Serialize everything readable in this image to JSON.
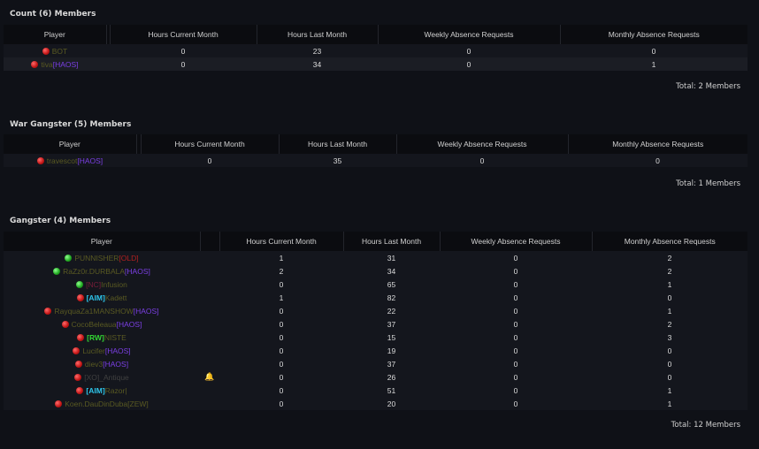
{
  "headers": {
    "player": "Player",
    "hours_current": "Hours Current Month",
    "hours_last": "Hours Last Month",
    "weekly": "Weekly Absence Requests",
    "monthly": "Monthly Absence Requests"
  },
  "colors": {
    "background": "#0f1117",
    "online": "#1fa61f",
    "offline": "#c21414",
    "haos_tag": "#7b3fe4",
    "aim_tag": "#2ec4e8",
    "rw_tag": "#33d433"
  },
  "sections": [
    {
      "title": "Count (6) Members",
      "total": "Total: 2 Members",
      "rows": [
        {
          "status": "red",
          "parts": [
            {
              "t": "BOT",
              "c": "name"
            }
          ],
          "hc": "0",
          "hl": "23",
          "w": "0",
          "m": "0"
        },
        {
          "status": "red",
          "parts": [
            {
              "t": "tiva",
              "c": "name"
            },
            {
              "t": "[HAOS]",
              "c": "tag-haos"
            }
          ],
          "hc": "0",
          "hl": "34",
          "w": "0",
          "m": "1"
        }
      ]
    },
    {
      "title": "War Gangster (5) Members",
      "total": "Total: 1 Members",
      "rows": [
        {
          "status": "red",
          "parts": [
            {
              "t": "travescot",
              "c": "name"
            },
            {
              "t": "[HAOS]",
              "c": "tag-haos"
            }
          ],
          "hc": "0",
          "hl": "35",
          "w": "0",
          "m": "0"
        }
      ]
    },
    {
      "title": "Gangster (4) Members",
      "total": "Total: 12 Members",
      "rows": [
        {
          "status": "green",
          "parts": [
            {
              "t": "PUNNISHER",
              "c": "name"
            },
            {
              "t": "[OLD]",
              "c": "tag-old"
            }
          ],
          "hc": "1",
          "hl": "31",
          "w": "0",
          "m": "2"
        },
        {
          "status": "green",
          "parts": [
            {
              "t": "RaZz0r.DURBALA",
              "c": "name"
            },
            {
              "t": "[HAOS]",
              "c": "tag-haos"
            }
          ],
          "hc": "2",
          "hl": "34",
          "w": "0",
          "m": "2"
        },
        {
          "status": "green",
          "parts": [
            {
              "t": "[NC]",
              "c": "tag-nc"
            },
            {
              "t": "Infusion",
              "c": "name"
            }
          ],
          "hc": "0",
          "hl": "65",
          "w": "0",
          "m": "1"
        },
        {
          "status": "red",
          "parts": [
            {
              "t": "[AIM]",
              "c": "tag-aim"
            },
            {
              "t": "Kadett",
              "c": "name"
            }
          ],
          "hc": "1",
          "hl": "82",
          "w": "0",
          "m": "0"
        },
        {
          "status": "red",
          "parts": [
            {
              "t": "RayquaZa1MANSHOW",
              "c": "name"
            },
            {
              "t": "[HAOS]",
              "c": "tag-haos"
            }
          ],
          "hc": "0",
          "hl": "22",
          "w": "0",
          "m": "1"
        },
        {
          "status": "red",
          "parts": [
            {
              "t": "CocoBeleaua",
              "c": "name"
            },
            {
              "t": "[HAOS]",
              "c": "tag-haos"
            }
          ],
          "hc": "0",
          "hl": "37",
          "w": "0",
          "m": "2"
        },
        {
          "status": "red",
          "parts": [
            {
              "t": "[RW]",
              "c": "tag-rw"
            },
            {
              "t": "NISTE",
              "c": "name"
            }
          ],
          "hc": "0",
          "hl": "15",
          "w": "0",
          "m": "3"
        },
        {
          "status": "red",
          "parts": [
            {
              "t": "Lucifer",
              "c": "name"
            },
            {
              "t": "[HAOS]",
              "c": "tag-haos"
            }
          ],
          "hc": "0",
          "hl": "19",
          "w": "0",
          "m": "0"
        },
        {
          "status": "red",
          "parts": [
            {
              "t": "diev3",
              "c": "name"
            },
            {
              "t": "[HAOS]",
              "c": "tag-haos"
            }
          ],
          "hc": "0",
          "hl": "37",
          "w": "0",
          "m": "0"
        },
        {
          "status": "red",
          "parts": [
            {
              "t": "[XO]_Antique",
              "c": "tag-xo"
            }
          ],
          "bell": true,
          "hc": "0",
          "hl": "26",
          "w": "0",
          "m": "0"
        },
        {
          "status": "red",
          "parts": [
            {
              "t": "[AIM]",
              "c": "tag-aim"
            },
            {
              "t": "Razor|",
              "c": "name"
            }
          ],
          "hc": "0",
          "hl": "51",
          "w": "0",
          "m": "1"
        },
        {
          "status": "red",
          "parts": [
            {
              "t": "Koen.DauDinDuba",
              "c": "name"
            },
            {
              "t": "[ZEW]",
              "c": "tag-zew"
            }
          ],
          "hc": "0",
          "hl": "20",
          "w": "0",
          "m": "1"
        }
      ]
    }
  ]
}
